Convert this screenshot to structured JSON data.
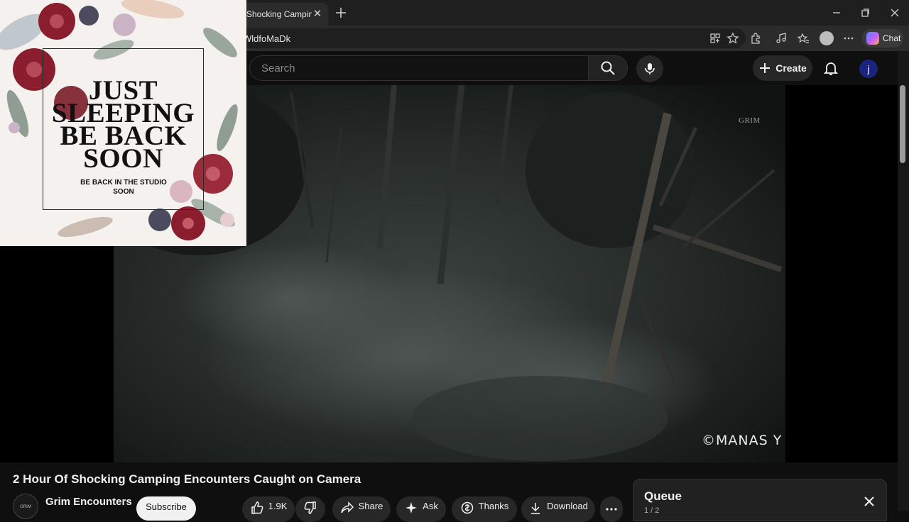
{
  "browser": {
    "tab": {
      "title": "Shocking Camping"
    },
    "address": {
      "url_fragment": "WldfoMaDk"
    },
    "chat_label": "Chat"
  },
  "masthead": {
    "search_placeholder": "Search",
    "create_label": "Create",
    "avatar_letter": "j"
  },
  "video": {
    "watermark_top": "GRIM",
    "watermark_author": "©MANAS Y",
    "title": "2 Hour Of Shocking Camping Encounters Caught on Camera"
  },
  "overlay": {
    "title_lines": [
      "JUST",
      "SLEEPING",
      "BE BACK",
      "SOON"
    ],
    "subtitle_lines": [
      "BE BACK IN THE STUDIO",
      "SOON"
    ]
  },
  "channel": {
    "name": "Grim Encounters",
    "avatar_text": "GRIM",
    "subscribe_label": "Subscribe"
  },
  "actions": {
    "likes": "1.9K",
    "share": "Share",
    "ask": "Ask",
    "thanks": "Thanks",
    "download": "Download"
  },
  "queue": {
    "title": "Queue",
    "count": "1 / 2"
  },
  "colors": {
    "background": "#0f0f0f",
    "chrome": "#1f1f1f",
    "overlay_bg": "#f4f1ee",
    "flower_red": "#8b1e2e"
  }
}
